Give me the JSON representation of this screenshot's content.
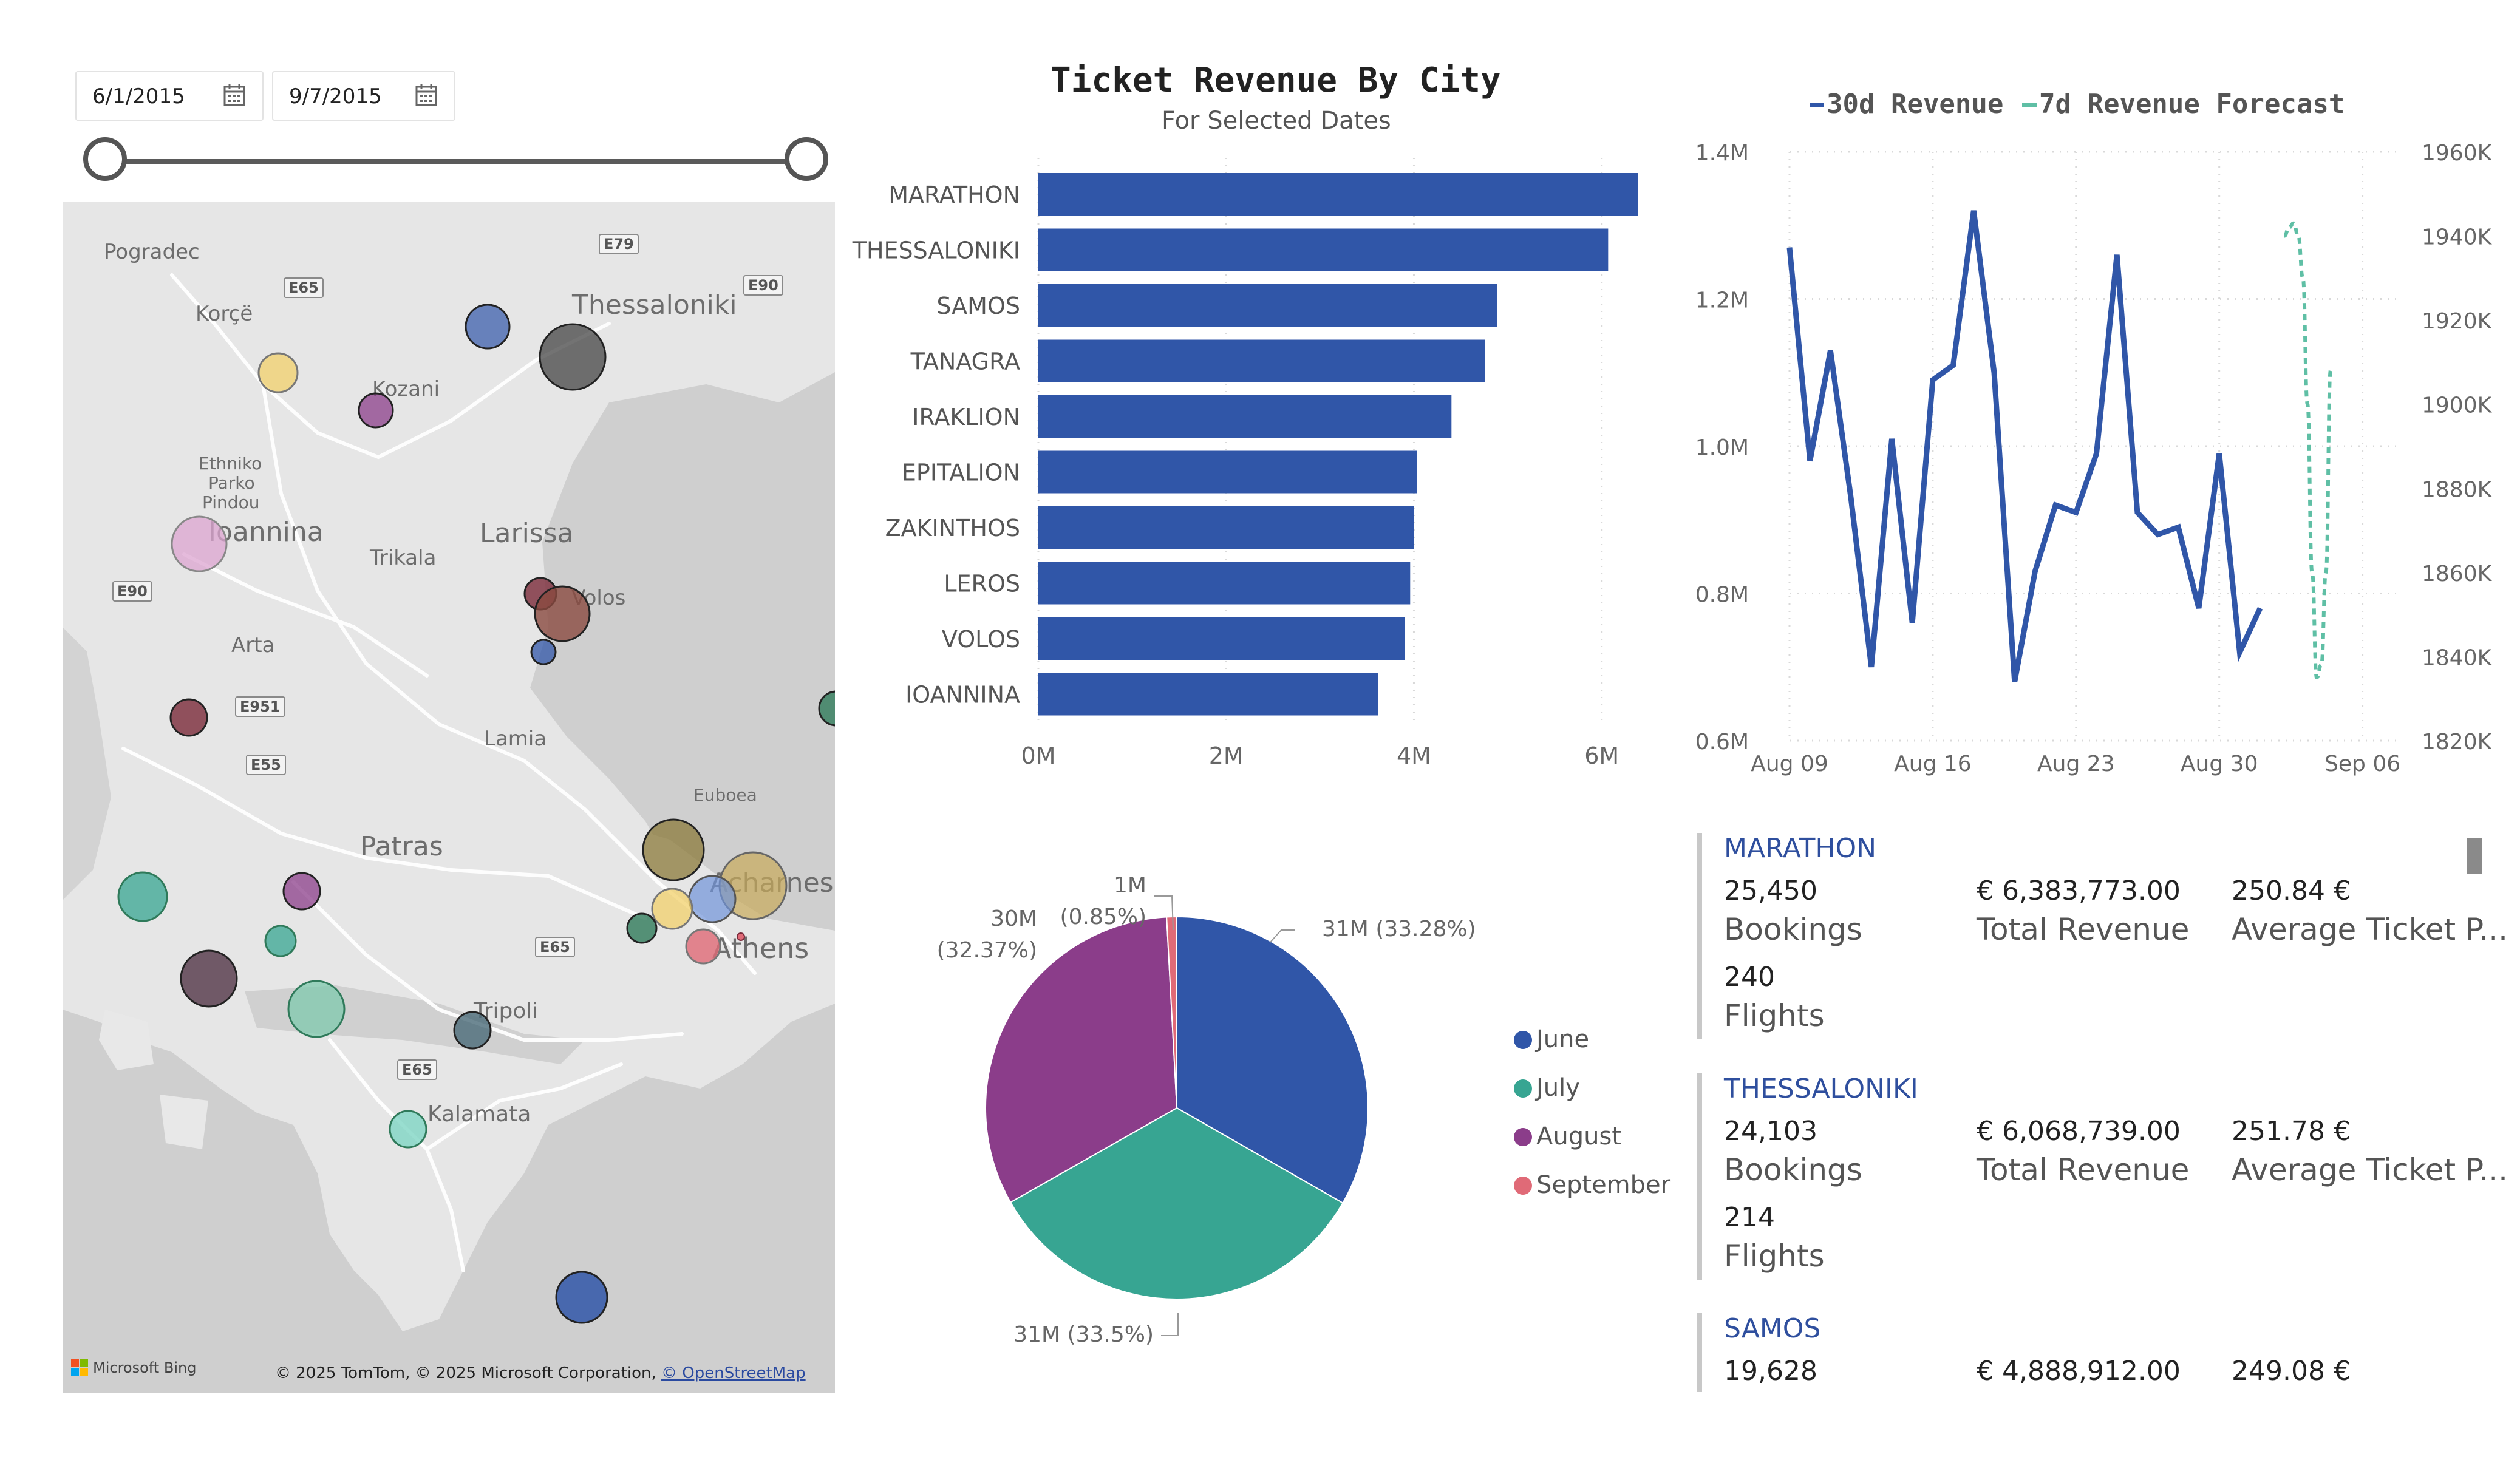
{
  "date_filter": {
    "start_date": "6/1/2015",
    "end_date": "9/7/2015",
    "calendar_icon": "calendar-icon",
    "slider_range": [
      0,
      1
    ]
  },
  "map": {
    "place_labels": [
      "Pogradec",
      "Korçë",
      "Kozani",
      "Thessaloniki",
      "Ethniko",
      "Parko",
      "Pindou",
      "Ioannina",
      "Trikala",
      "Larissa",
      "Volos",
      "Arta",
      "Lamia",
      "Euboea",
      "Patras",
      "Acharnes",
      "Athens",
      "Tripoli",
      "Kalamata"
    ],
    "road_labels": [
      "E79",
      "E65",
      "E90",
      "E90",
      "E951",
      "E55",
      "E65",
      "E65"
    ],
    "attribution": "© 2025 TomTom, © 2025 Microsoft Corporation,",
    "attribution_link": "© OpenStreetMap",
    "provider": "Microsoft Bing"
  },
  "bar_chart_header": {
    "title": "Ticket Revenue By City",
    "subtitle": "For Selected Dates"
  },
  "pie_legend": {
    "june": "June",
    "july": "July",
    "august": "August",
    "september": "September"
  },
  "line_legend": {
    "actual": "30d Revenue",
    "forecast": "7d Revenue Forecast"
  },
  "cards": [
    {
      "city": "MARATHON",
      "bookings": "25,450",
      "bookings_label": "Bookings",
      "revenue": "€ 6,383,773.00",
      "revenue_label": "Total Revenue",
      "avg": "250.84 €",
      "avg_label": "Average Ticket P...",
      "flights": "240",
      "flights_label": "Flights"
    },
    {
      "city": "THESSALONIKI",
      "bookings": "24,103",
      "bookings_label": "Bookings",
      "revenue": "€ 6,068,739.00",
      "revenue_label": "Total Revenue",
      "avg": "251.78 €",
      "avg_label": "Average Ticket P...",
      "flights": "214",
      "flights_label": "Flights"
    },
    {
      "city": "SAMOS",
      "bookings": "19,628",
      "revenue": "€ 4,888,912.00",
      "avg": "249.08 €"
    }
  ],
  "chart_data": [
    {
      "type": "bar",
      "orientation": "horizontal",
      "title": "Ticket Revenue By City",
      "subtitle": "For Selected Dates",
      "categories": [
        "MARATHON",
        "THESSALONIKI",
        "SAMOS",
        "TANAGRA",
        "IRAKLION",
        "EPITALION",
        "ZAKINTHOS",
        "LEROS",
        "VOLOS",
        "IOANNINA"
      ],
      "values": [
        6383773,
        6068739,
        4888912,
        4760000,
        4400000,
        4030000,
        4000000,
        3960000,
        3900000,
        3620000
      ],
      "xlim": [
        0,
        6500000
      ],
      "xticks": [
        "0M",
        "2M",
        "4M",
        "6M"
      ],
      "xtick_values": [
        0,
        2000000,
        4000000,
        6000000
      ],
      "bar_color": "#3056a8",
      "grid": true
    },
    {
      "type": "pie",
      "series": [
        {
          "name": "June",
          "value": 31,
          "label": "31M (33.28%)",
          "color": "#3056a8"
        },
        {
          "name": "July",
          "value": 31,
          "label": "31M (33.5%)",
          "color": "#37a592"
        },
        {
          "name": "August",
          "value": 30,
          "label": "30M\n(32.37%)",
          "color": "#8b3d8a"
        },
        {
          "name": "September",
          "value": 1,
          "label": "1M\n(0.85%)",
          "color": "#e06a77"
        }
      ],
      "shares": [
        33.28,
        33.5,
        32.37,
        0.85
      ],
      "legend": "right"
    },
    {
      "type": "line",
      "x_ticks": [
        "Aug 09",
        "Aug 16",
        "Aug 23",
        "Aug 30",
        "Sep 06"
      ],
      "y_left_ticks": [
        "0.6M",
        "0.8M",
        "1.0M",
        "1.2M",
        "1.4M"
      ],
      "y_left_range": [
        0.6,
        1.4
      ],
      "y_right_ticks": [
        "1820K",
        "1840K",
        "1860K",
        "1880K",
        "1900K",
        "1920K",
        "1940K",
        "1960K"
      ],
      "y_right_range": [
        1820,
        1960
      ],
      "series": [
        {
          "name": "30d Revenue",
          "axis": "left",
          "unit": "M",
          "color": "#3056a8",
          "style": "solid",
          "x_day_offset": [
            0,
            1,
            2,
            3,
            4,
            5,
            6,
            7,
            8,
            9,
            10,
            11,
            12,
            13,
            14,
            15,
            16,
            17,
            18,
            19,
            20,
            21,
            22,
            23,
            24,
            25,
            26,
            27,
            28,
            29
          ],
          "values": [
            1.27,
            0.98,
            1.13,
            0.93,
            0.7,
            1.01,
            0.76,
            1.09,
            1.11,
            1.32,
            1.1,
            0.68,
            0.83,
            0.92,
            0.91,
            0.99,
            1.26,
            0.91,
            0.88,
            0.89,
            0.78,
            0.99,
            0.72,
            0.78
          ]
        },
        {
          "name": "7d Revenue Forecast",
          "axis": "right",
          "unit": "K",
          "color": "#5fbfa5",
          "style": "dashed",
          "values": [
            1940,
            1942,
            1943,
            1940,
            1930,
            1900,
            1860,
            1835,
            1838,
            1860,
            1908
          ]
        }
      ],
      "legend": "top",
      "grid": true
    }
  ]
}
